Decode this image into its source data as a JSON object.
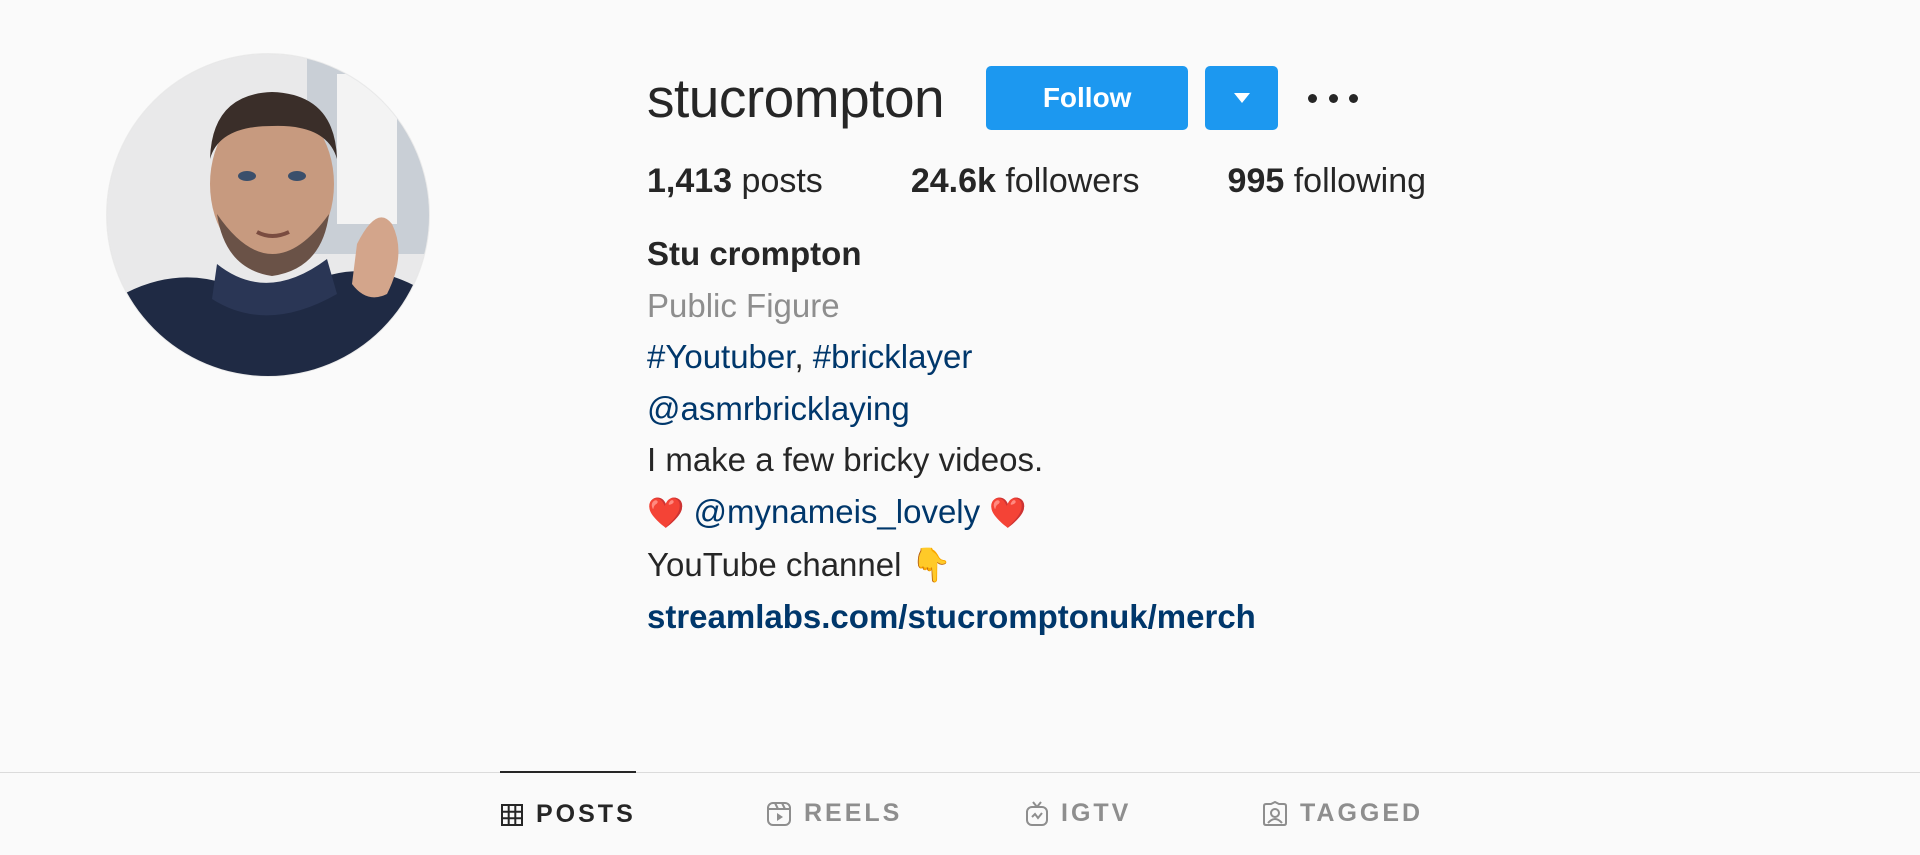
{
  "profile": {
    "username": "stucrompton",
    "follow_label": "Follow",
    "stats": {
      "posts_count": "1,413",
      "posts_label": "posts",
      "followers_count": "24.6k",
      "followers_label": "followers",
      "following_count": "995",
      "following_label": "following"
    },
    "bio": {
      "full_name": "Stu crompton",
      "category": "Public Figure",
      "hashtag_1": "#Youtuber",
      "hashtag_sep": ", ",
      "hashtag_2": "#bricklayer",
      "mention_1": "@asmrbricklaying",
      "line_text": "I make a few bricky videos.",
      "heart_left": "❤️",
      "mention_2": "@mynameis_lovely",
      "heart_right": "❤️",
      "youtube_text": "YouTube channel",
      "pointing_emoji": "👇",
      "external_link": "streamlabs.com/stucromptonuk/merch"
    }
  },
  "tabs": [
    {
      "label": "POSTS",
      "icon": "grid-icon",
      "active": true
    },
    {
      "label": "REELS",
      "icon": "reels-icon",
      "active": false
    },
    {
      "label": "IGTV",
      "icon": "igtv-icon",
      "active": false
    },
    {
      "label": "TAGGED",
      "icon": "tagged-icon",
      "active": false
    }
  ],
  "colors": {
    "accent": "#1c98f0",
    "link": "#00376b",
    "muted": "#8e8e8e",
    "background": "#fafafa"
  }
}
